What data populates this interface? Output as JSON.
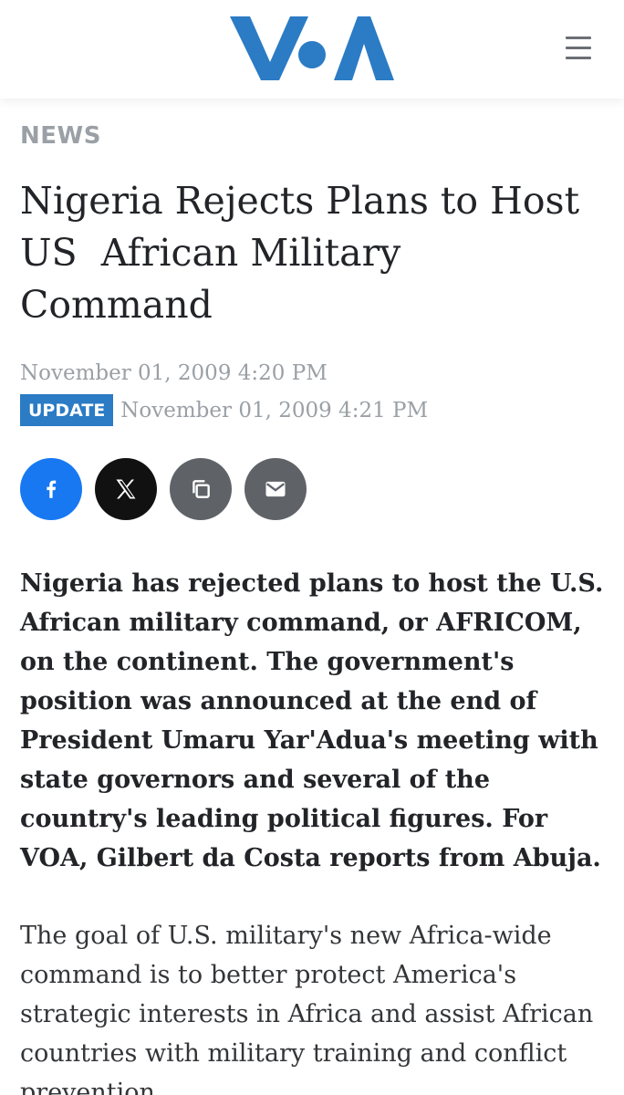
{
  "header": {
    "logo_text": "VOA",
    "brand_color": "#2b7bc5",
    "menu_icon": "hamburger-menu-icon"
  },
  "article": {
    "category": "NEWS",
    "title": "Nigeria Rejects Plans to Host\nUS  African Military\nCommand",
    "published": "November 01, 2009 4:20 PM",
    "update_badge": "UPDATE",
    "updated": "November 01, 2009 4:21 PM",
    "lead": "Nigeria has rejected plans to host the U.S. African military command, or AFRICOM, on the continent. The government's position was announced at the end of President Umaru Yar'Adua's meeting with state governors and several of the country's leading political figures. For VOA, Gilbert da Costa reports from Abuja.",
    "body": "The goal of U.S. military's new Africa-wide command is to better protect America's strategic interests in Africa and assist African countries with military training and conflict prevention."
  },
  "share": {
    "buttons": [
      {
        "name": "facebook",
        "icon": "facebook-icon",
        "color": "#1778f2"
      },
      {
        "name": "x",
        "icon": "x-icon",
        "color": "#111111"
      },
      {
        "name": "copy-link",
        "icon": "copy-icon",
        "color": "#5f6368"
      },
      {
        "name": "email",
        "icon": "envelope-icon",
        "color": "#5f6368"
      }
    ]
  }
}
